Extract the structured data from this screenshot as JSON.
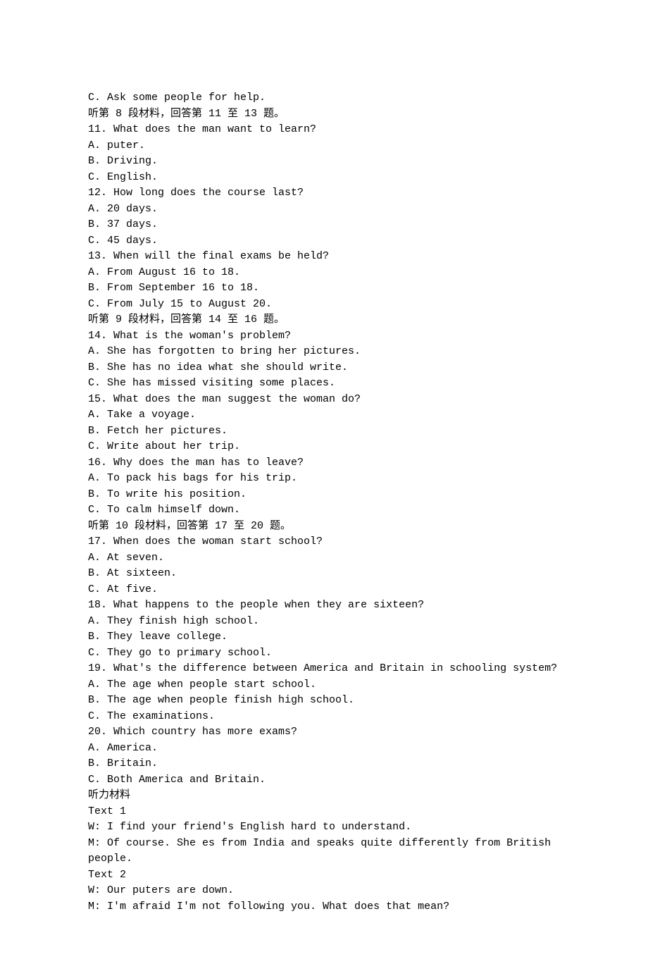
{
  "lines": [
    "C. Ask some people for help.",
    "听第 8 段材料，回答第 11 至 13 题。",
    "11. What does the man want to learn?",
    "A. puter.",
    "B. Driving.",
    "C. English.",
    "12. How long does the course last?",
    "A. 20 days.",
    "B. 37 days.",
    "C. 45 days.",
    "13. When will the final exams be held?",
    "A. From August 16 to 18.",
    "B. From September 16 to 18.",
    "C. From July 15 to August 20.",
    "听第 9 段材料，回答第 14 至 16 题。",
    "14. What is the woman's problem?",
    "A. She has forgotten to bring her pictures.",
    "B. She has no idea what she should write.",
    "C. She has missed visiting some places.",
    "15. What does the man suggest the woman do?",
    "A. Take a voyage.",
    "B. Fetch her pictures.",
    "C. Write about her trip.",
    "16. Why does the man has to leave?",
    "A. To pack his bags for his trip.",
    "B. To write his position.",
    "C. To calm himself down.",
    "听第 10 段材料，回答第 17 至 20 题。",
    "17. When does the woman start school?",
    "A. At seven.",
    "B. At sixteen.",
    "C. At five.",
    "18. What happens to the people when they are sixteen?",
    "A. They finish high school.",
    "B. They leave college.",
    "C. They go to primary school.",
    "19. What's the difference between America and Britain in schooling system?",
    "A. The age when people start school.",
    "B. The age when people finish high school.",
    "C. The examinations.",
    "20. Which country has more exams?",
    "A. America.",
    "B. Britain.",
    "C. Both America and Britain.",
    "听力材料",
    "Text 1",
    "W: I find your friend's English hard to understand.",
    "M: Of course. She es from India and speaks quite differently from British people.",
    "Text 2",
    "W: Our puters are down.",
    "M: I'm afraid I'm not following you. What does that mean?"
  ]
}
